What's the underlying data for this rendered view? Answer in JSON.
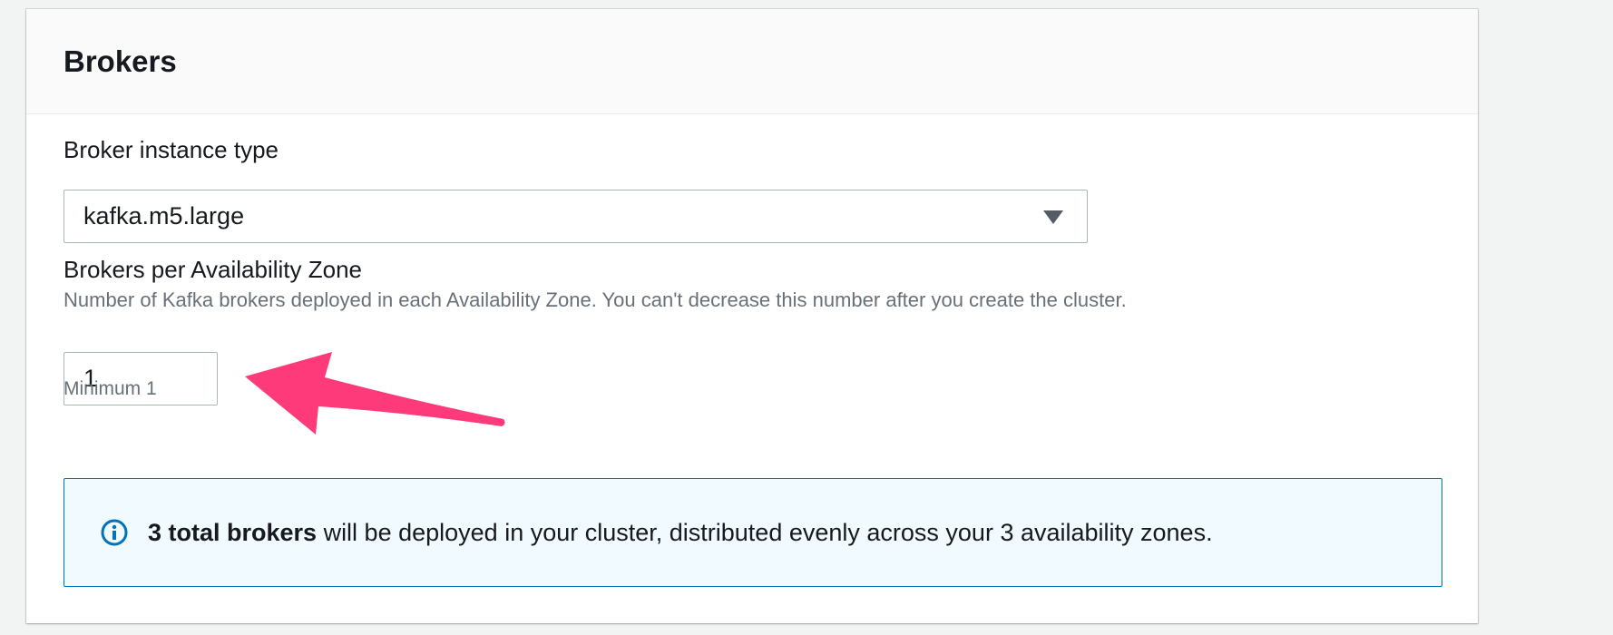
{
  "panel": {
    "title": "Brokers"
  },
  "instance_type": {
    "label": "Broker instance type",
    "selected_value": "kafka.m5.large"
  },
  "brokers_per_az": {
    "label": "Brokers per Availability Zone",
    "description": "Number of Kafka brokers deployed in each Availability Zone. You can't decrease this number after you create the cluster.",
    "value": "1",
    "constraint": "Minimum 1"
  },
  "info": {
    "bold_text": "3 total brokers",
    "rest_text": " will be deployed in your cluster, distributed evenly across your 3 availability zones.",
    "icon": "info-icon"
  },
  "colors": {
    "accent": "#0073bb",
    "info_background": "#f1faff",
    "annotation_arrow": "#ff3a7a"
  }
}
